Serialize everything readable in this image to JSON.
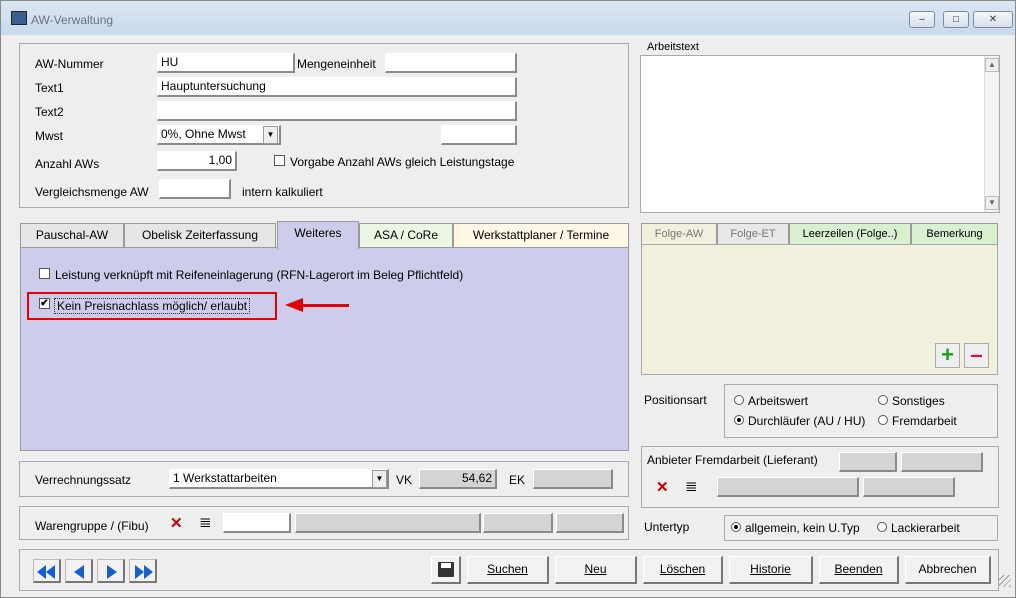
{
  "window": {
    "title": "AW-Verwaltung",
    "min": "–",
    "max": "□",
    "close": "✕"
  },
  "form": {
    "aw_nummer_label": "AW-Nummer",
    "aw_nummer_value": "HU",
    "mengeneinheit_label": "Mengeneinheit",
    "mengeneinheit_value": "",
    "text1_label": "Text1",
    "text1_value": "Hauptuntersuchung",
    "text2_label": "Text2",
    "text2_value": "",
    "mwst_label": "Mwst",
    "mwst_value": "0%, Ohne Mwst",
    "anzahl_label": "Anzahl AWs",
    "anzahl_value": "1,00",
    "vorgabe_label": "Vorgabe Anzahl AWs gleich Leistungstage",
    "vergleich_label": "Vergleichsmenge AW",
    "vergleich_value": "",
    "intern_label": "intern kalkuliert"
  },
  "arbeitstext": {
    "label": "Arbeitstext",
    "value": ""
  },
  "tabs": [
    "Pauschal-AW",
    "Obelisk Zeiterfassung",
    "Weiteres",
    "ASA / CoRe",
    "Werkstattplaner / Termine"
  ],
  "weiteres": {
    "rfn_label": "Leistung verknüpft mit Reifeneinlagerung (RFN-Lagerort im Beleg Pflichtfeld)",
    "preis_label": "Kein Preisnachlass möglich/ erlaubt",
    "check_mark": "✔"
  },
  "right_tabs": [
    "Folge-AW",
    "Folge-ET",
    "Leerzeilen (Folge..)",
    "Bemerkung"
  ],
  "positionsart": {
    "label": "Positionsart",
    "options": [
      "Arbeitswert",
      "Sonstiges",
      "Durchläufer (AU / HU)",
      "Fremdarbeit"
    ],
    "selected": "Durchläufer (AU / HU)"
  },
  "anbieter": {
    "label": "Anbieter Fremdarbeit (Lieferant)"
  },
  "untertyp": {
    "label": "Untertyp",
    "options": [
      "allgemein, kein U.Typ",
      "Lackierarbeit"
    ],
    "selected": "allgemein, kein U.Typ"
  },
  "verrechnung": {
    "label": "Verrechnungssatz",
    "value": "1 Werkstattarbeiten",
    "vk_label": "VK",
    "vk_value": "54,62",
    "ek_label": "EK",
    "ek_value": ""
  },
  "warengruppe": {
    "label": "Warengruppe / (Fibu)"
  },
  "buttons": {
    "suchen": "Suchen",
    "neu": "Neu",
    "loeschen": "Löschen",
    "historie": "Historie",
    "beenden": "Beenden",
    "abbrechen": "Abbrechen"
  },
  "icons": {
    "plus": "+",
    "minus": "–",
    "x": "✕",
    "list": "≣",
    "dropdown": "▼"
  },
  "colors": {
    "tab_panel": "#cdcdeb",
    "right_panel": "#f0f0dc",
    "highlight": "#e00000",
    "nav_blue": "#1560d0"
  }
}
